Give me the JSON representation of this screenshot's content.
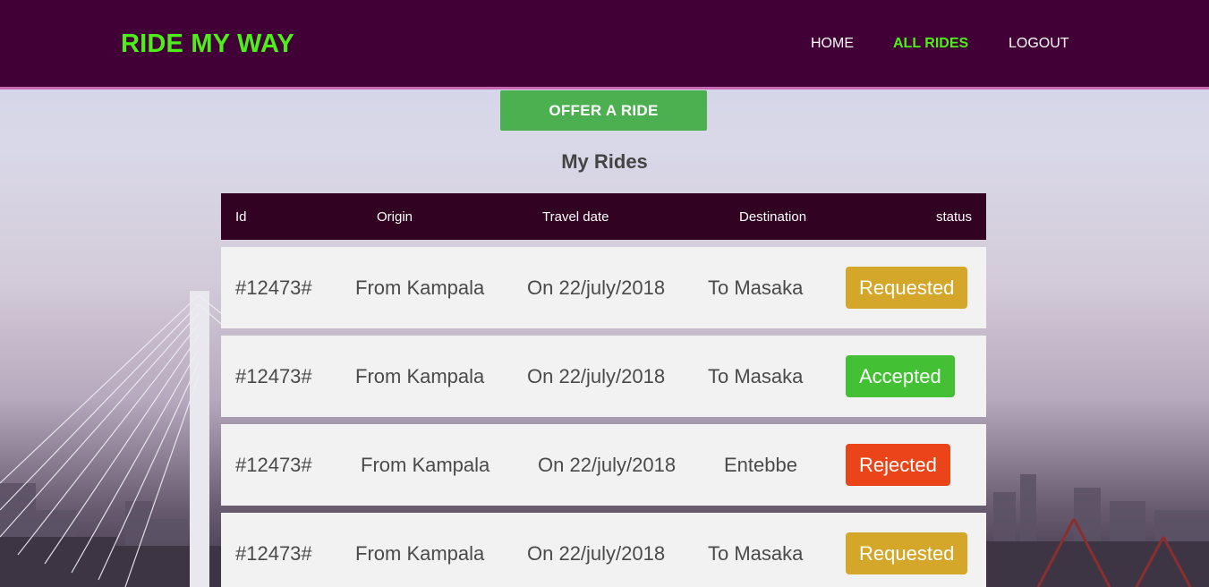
{
  "header": {
    "brand": "RIDE MY WAY",
    "nav": {
      "home": "HOME",
      "all_rides": "ALL RIDES",
      "logout": "LOGOUT"
    }
  },
  "actions": {
    "offer_ride": "OFFER A RIDE"
  },
  "section_title": "My Rides",
  "table": {
    "headers": {
      "id": "Id",
      "origin": "Origin",
      "date": "Travel date",
      "destination": "Destination",
      "status": "status"
    },
    "rows": [
      {
        "id": "#12473#",
        "origin": "From Kampala",
        "date": "On 22/july/2018",
        "destination": "To Masaka",
        "status": "Requested",
        "status_color": "#d4a62a"
      },
      {
        "id": "#12473#",
        "origin": "From Kampala",
        "date": "On 22/july/2018",
        "destination": "To Masaka",
        "status": "Accepted",
        "status_color": "#43c033"
      },
      {
        "id": "#12473#",
        "origin": "From Kampala",
        "date": "On 22/july/2018",
        "destination": "Entebbe",
        "status": "Rejected",
        "status_color": "#ea4418"
      },
      {
        "id": "#12473#",
        "origin": "From Kampala",
        "date": "On 22/july/2018",
        "destination": "To Masaka",
        "status": "Requested",
        "status_color": "#d4a62a"
      }
    ]
  },
  "colors": {
    "header_bg": "#420136",
    "brand_accent": "#4cf018",
    "button_green": "#4caf50",
    "table_head_bg": "#320222"
  }
}
